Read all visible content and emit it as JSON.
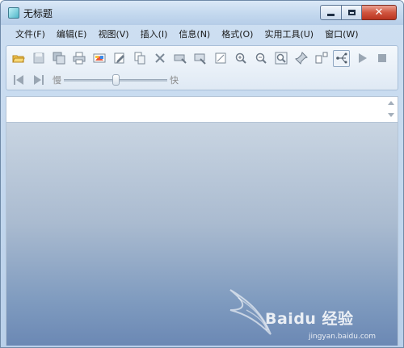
{
  "window": {
    "title": "无标题"
  },
  "menu": [
    "文件(F)",
    "编辑(E)",
    "视图(V)",
    "插入(I)",
    "信息(N)",
    "格式(O)",
    "实用工具(U)",
    "窗口(W)"
  ],
  "toolbar": {
    "row1": [
      "open-folder-icon",
      "save-icon",
      "save-all-icon",
      "print-icon",
      "color-icon",
      "edit-icon",
      "copy-icon",
      "delete-icon",
      "erase-icon",
      "properties-icon",
      "frame-icon",
      "zoom-in-icon",
      "zoom-out-icon",
      "zoom-fit-icon",
      "pin-icon",
      "align-icon",
      "connect-icon",
      "play-icon",
      "stop-icon"
    ],
    "active_tool": "connect-icon"
  },
  "playback": {
    "slow_label": "慢",
    "fast_label": "快",
    "speed_fraction": 0.5
  },
  "watermark": {
    "brand": "Baidu 经验",
    "url": "jingyan.baidu.com"
  }
}
